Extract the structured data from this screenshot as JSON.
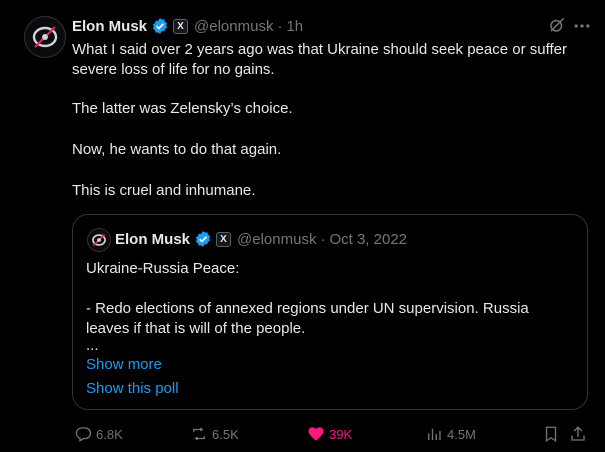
{
  "tweet": {
    "author_name": "Elon Musk",
    "badge_label": "X",
    "handle": "@elonmusk",
    "separator": "·",
    "time": "1h",
    "paragraphs": [
      "What I said over 2 years ago was that Ukraine should seek peace or suffer severe loss of life for no gains.",
      "The latter was Zelensky’s choice.",
      "Now, he wants to do that again.",
      "This is cruel and inhumane."
    ]
  },
  "quoted_tweet": {
    "author_name": "Elon Musk",
    "badge_label": "X",
    "handle": "@elonmusk",
    "separator": "·",
    "date": "Oct 3, 2022",
    "lines": [
      "Ukraine-Russia Peace:",
      "",
      "- Redo elections of annexed regions under UN supervision. Russia leaves if that is will of the people.",
      "..."
    ],
    "show_more": "Show more",
    "show_poll": "Show this poll"
  },
  "actions": {
    "replies": "6.8K",
    "reposts": "6.5K",
    "likes": "39K",
    "views": "4.5M"
  },
  "colors": {
    "background": "#000000",
    "text": "#e7e9ea",
    "muted": "#71767b",
    "link": "#1d9bf0",
    "like": "#f91880",
    "verified": "#1d9bf0"
  },
  "icons": {
    "more": "more-horizontal-icon",
    "grok": "grok-icon",
    "reply": "reply-icon",
    "repost": "repost-icon",
    "like": "heart-filled-icon",
    "views": "views-icon",
    "bookmark": "bookmark-icon",
    "share": "share-icon"
  }
}
